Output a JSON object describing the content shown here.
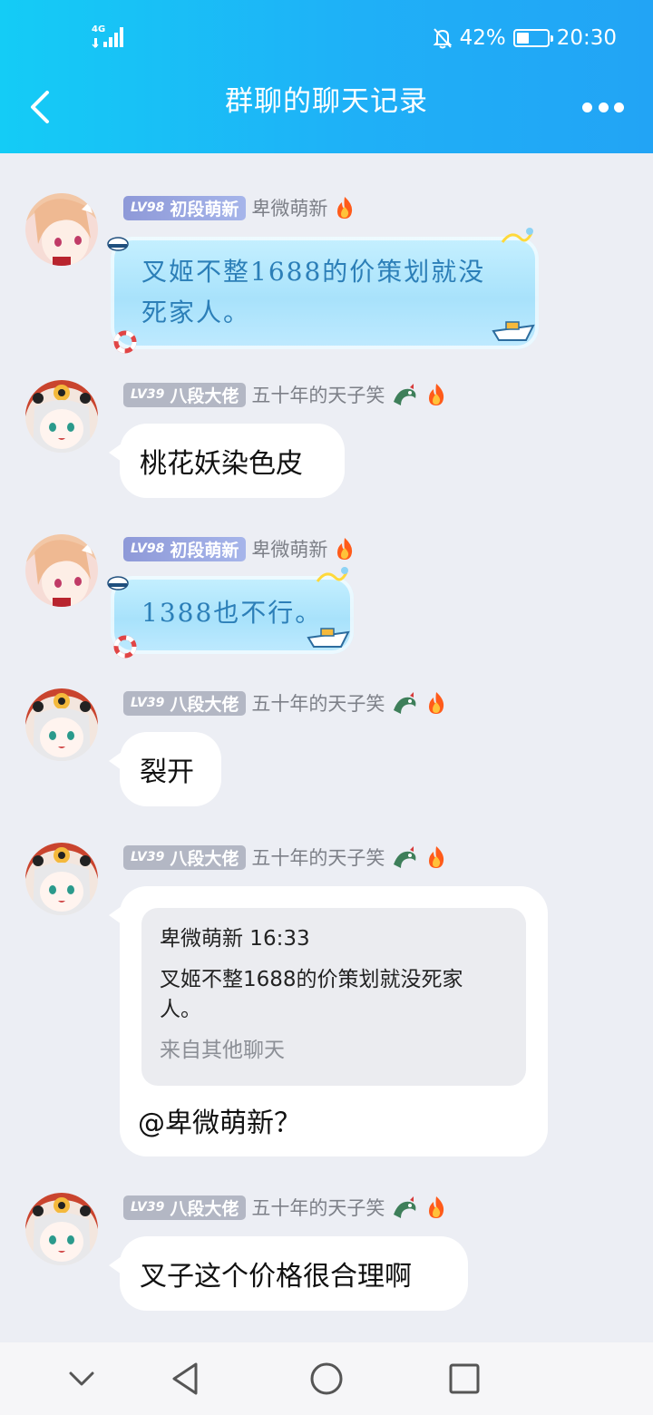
{
  "status_bar": {
    "network": "4G",
    "battery_percent": "42%",
    "battery_level": 0.42,
    "time": "20:30"
  },
  "header": {
    "title": "群聊的聊天记录"
  },
  "colors": {
    "header_start": "#14ccf6",
    "header_end": "#22a4f5",
    "background": "#eceef4"
  },
  "messages": [
    {
      "level_label": "LV98",
      "rank": "初段萌新",
      "sender": "卑微萌新",
      "bubble_style": "fancy",
      "text_line1": "叉姬不整1688的价策划就没",
      "text_line2": "死家人。"
    },
    {
      "level_label": "LV39",
      "rank": "八段大佬",
      "sender": "五十年的天子笑",
      "bubble_style": "plain",
      "text": "桃花妖染色皮"
    },
    {
      "level_label": "LV98",
      "rank": "初段萌新",
      "sender": "卑微萌新",
      "bubble_style": "fancy",
      "text": "1388也不行。"
    },
    {
      "level_label": "LV39",
      "rank": "八段大佬",
      "sender": "五十年的天子笑",
      "bubble_style": "plain",
      "text": "裂开"
    },
    {
      "level_label": "LV39",
      "rank": "八段大佬",
      "sender": "五十年的天子笑",
      "bubble_style": "reply",
      "quote": {
        "header": "卑微萌新 16:33",
        "line1": "叉姬不整1688的价策划就没死家",
        "line2": "人。",
        "source": "来自其他聊天"
      },
      "text": "@卑微萌新？"
    },
    {
      "level_label": "LV39",
      "rank": "八段大佬",
      "sender": "五十年的天子笑",
      "bubble_style": "plain",
      "text": "叉子这个价格很合理啊"
    }
  ],
  "nav_bar": {
    "icons": [
      "chevron-down-icon",
      "back-triangle-icon",
      "home-circle-icon",
      "recent-square-icon"
    ]
  }
}
